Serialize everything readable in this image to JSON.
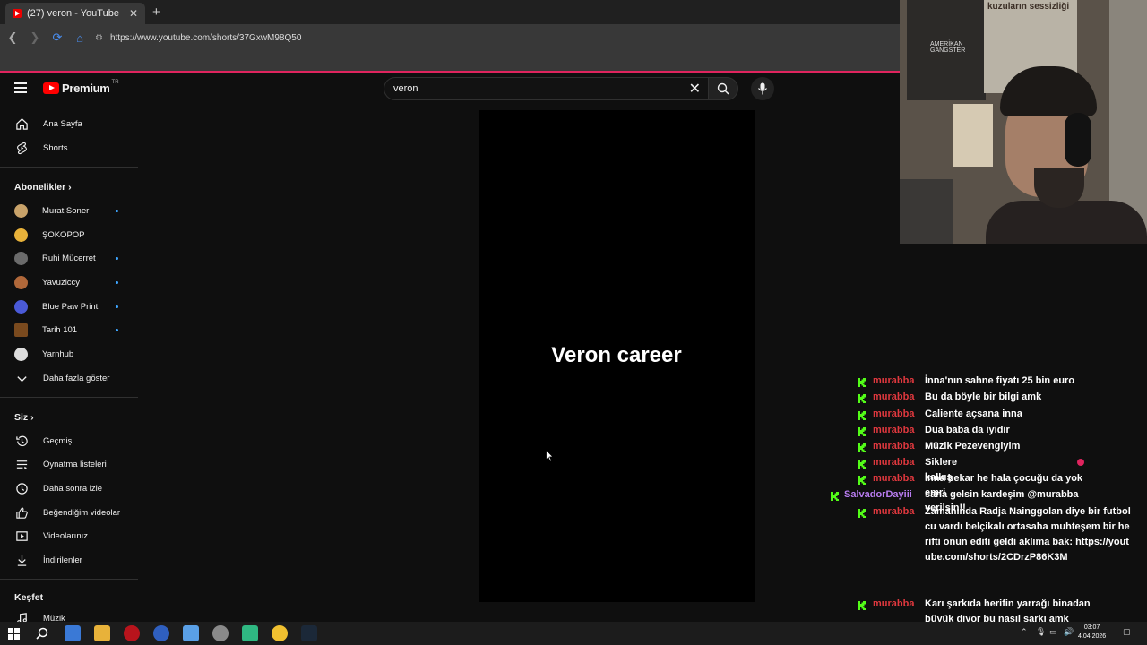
{
  "browser": {
    "tab_title": "(27) veron - YouTube",
    "url": "https://www.youtube.com/shorts/37GxwM98Q50"
  },
  "youtube": {
    "logo_text": "Premium",
    "logo_region": "TR",
    "search_value": "veron"
  },
  "sidebar": {
    "main": [
      {
        "label": "Ana Sayfa",
        "icon": "home-icon"
      },
      {
        "label": "Shorts",
        "icon": "shorts-icon"
      }
    ],
    "subscriptions_header": "Abonelikler",
    "subscriptions": [
      {
        "label": "Murat Soner",
        "new": true,
        "color": "#c9a36a"
      },
      {
        "label": "ŞOKOPOP",
        "new": false,
        "color": "#e8b23a"
      },
      {
        "label": "Ruhi Mücerret",
        "new": true,
        "color": "#6b6b6b"
      },
      {
        "label": "Yavuzlccy",
        "new": true,
        "color": "#b0683a"
      },
      {
        "label": "Blue Paw Print",
        "new": true,
        "color": "#4a5ad8"
      },
      {
        "label": "Tarih 101",
        "new": true,
        "color": "#7a4a1e"
      },
      {
        "label": "Yarnhub",
        "new": false,
        "color": "#dddddd"
      }
    ],
    "show_more": "Daha fazla göster",
    "you_header": "Siz",
    "you_items": [
      {
        "label": "Geçmiş",
        "icon": "history-icon"
      },
      {
        "label": "Oynatma listeleri",
        "icon": "playlists-icon"
      },
      {
        "label": "Daha sonra izle",
        "icon": "watch-later-icon"
      },
      {
        "label": "Beğendiğim videolar",
        "icon": "liked-videos-icon"
      },
      {
        "label": "Videolarınız",
        "icon": "your-videos-icon"
      },
      {
        "label": "İndirilenler",
        "icon": "downloads-icon"
      }
    ],
    "explore_header": "Keşfet",
    "explore_items": [
      {
        "label": "Müzik",
        "icon": "music-icon"
      }
    ]
  },
  "player": {
    "overlay_text": "Veron career"
  },
  "webcam": {
    "poster_text_1": "AMERİKAN GANGSTER",
    "poster_text_2": "kuzuların sessizliği"
  },
  "chat": [
    {
      "user": "murabba",
      "user_color": "#e0383e",
      "message": "İnna'nın sahne fiyatı 25 bin euro"
    },
    {
      "user": "murabba",
      "user_color": "#e0383e",
      "message": "Bu da böyle bir bilgi amk"
    },
    {
      "user": "murabba",
      "user_color": "#e0383e",
      "message": "Caliente açsana inna"
    },
    {
      "user": "murabba",
      "user_color": "#e0383e",
      "message": "Dua baba da iyidir"
    },
    {
      "user": "murabba",
      "user_color": "#e0383e",
      "message": "Müzik Pezevengiyim"
    },
    {
      "user": "murabba",
      "user_color": "#e0383e",
      "message": "Siklere kalkış emri verilsin!!"
    },
    {
      "user": "murabba",
      "user_color": "#e0383e",
      "message": "İnna bekar he hala çocuğu da yok"
    },
    {
      "user": "SalvadorDayiii",
      "user_color": "#b87cf0",
      "message": "sana gelsin kardeşim @murabba"
    },
    {
      "user": "murabba",
      "user_color": "#e0383e",
      "message": "Zamanında Radja Nainggolan diye bir futbolcu vardı belçikalı ortasaha muhteşem bir herifti onun editi geldi aklıma bak: https://youtube.com/shorts/2CDrzP86K3M"
    },
    {
      "user": "murabba",
      "user_color": "#e0383e",
      "message": "Karı şarkıda herifin yarrağı binadan büyük diyor bu nasıl şarkı amk LDKDLDMDL"
    }
  ],
  "taskbar": {
    "time": "03:07",
    "date": "4.04.2026"
  }
}
